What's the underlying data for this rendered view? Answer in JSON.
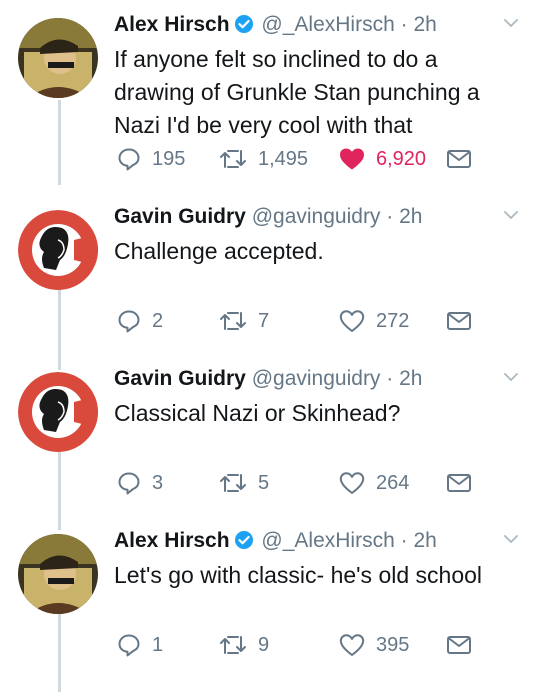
{
  "tweets": [
    {
      "name": "Alex Hirsch",
      "verified": true,
      "handle": "@_AlexHirsch",
      "time": "2h",
      "text": "If anyone felt so inclined to do a drawing of Grunkle Stan punching a Nazi I'd be very cool with that",
      "replies": "195",
      "retweets": "1,495",
      "likes": "6,920",
      "liked": true
    },
    {
      "name": "Gavin Guidry",
      "verified": false,
      "handle": "@gavinguidry",
      "time": "2h",
      "text": "Challenge accepted.",
      "replies": "2",
      "retweets": "7",
      "likes": "272",
      "liked": false
    },
    {
      "name": "Gavin Guidry",
      "verified": false,
      "handle": "@gavinguidry",
      "time": "2h",
      "text": "Classical Nazi or Skinhead?",
      "replies": "3",
      "retweets": "5",
      "likes": "264",
      "liked": false
    },
    {
      "name": "Alex Hirsch",
      "verified": true,
      "handle": "@_AlexHirsch",
      "time": "2h",
      "text": "Let's go with classic- he's old school",
      "replies": "1",
      "retweets": "9",
      "likes": "395",
      "liked": false
    }
  ],
  "separator": "·",
  "icons": {
    "reply": "reply-icon",
    "retweet": "retweet-icon",
    "like": "heart-icon",
    "message": "envelope-icon",
    "more": "chevron-down-icon",
    "verified": "verified-badge-icon"
  },
  "colors": {
    "like_active": "#e0245e",
    "verified": "#1da1f2",
    "secondary_text": "#657786",
    "thread_line": "#cfd9de"
  }
}
